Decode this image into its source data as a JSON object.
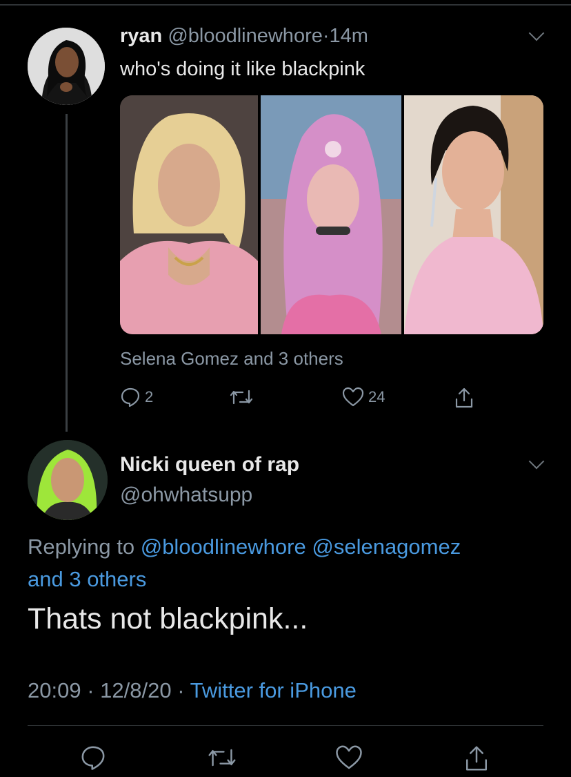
{
  "tweet1": {
    "display_name": "ryan",
    "handle": "@bloodlinewhore",
    "separator": "·",
    "time": "14m",
    "text": "who's doing it like blackpink",
    "tagged": "Selena Gomez and 3 others",
    "reply_count": "2",
    "like_count": "24"
  },
  "tweet2": {
    "display_name": "Nicki queen of rap",
    "handle": "@ohwhatsupp",
    "replying_prefix": "Replying to",
    "reply_mention_1": "@bloodlinewhore",
    "reply_mention_2": "@selenagomez",
    "reply_others": "and 3 others",
    "text": "Thats not blackpink...",
    "time": "20:09",
    "date": "12/8/20",
    "meta_sep": "·",
    "source": "Twitter for iPhone"
  },
  "colors": {
    "background": "#000000",
    "link": "#4a9ae0",
    "muted": "#8b98a5",
    "text": "#e8e8e8"
  },
  "icons": [
    "chevron-down-icon",
    "reply-icon",
    "retweet-icon",
    "like-icon",
    "share-icon"
  ]
}
